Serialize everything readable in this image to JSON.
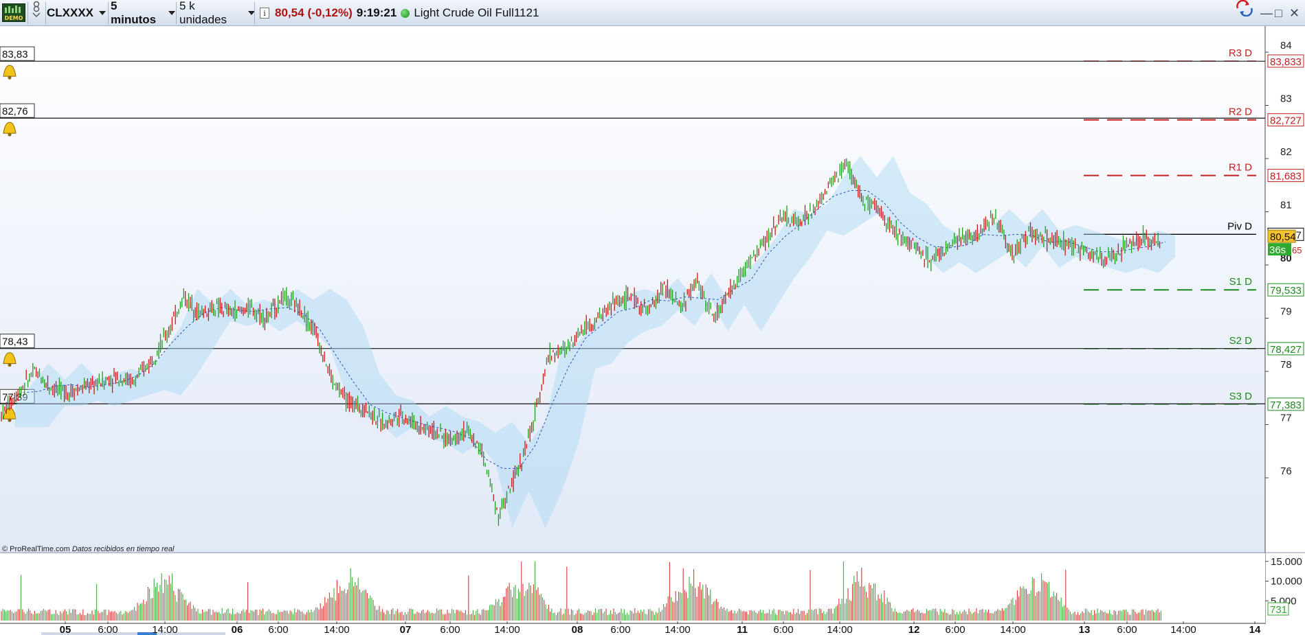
{
  "toolbar": {
    "logo": "DEMO",
    "symbol": "CLXXXX",
    "interval": "5 minutos",
    "units": "5 k unidades",
    "price": "80,54",
    "change": "(-0,12%)",
    "time": "9:19:21",
    "instrument": "Light Crude Oil Full1121"
  },
  "colors": {
    "up": "#1aa01a",
    "down": "#d01515",
    "resistance": "#c41e1e",
    "support": "#1d8a1d"
  },
  "icons": [
    "alert-bell-icon",
    "info-icon",
    "status-dot-icon",
    "minimize-icon",
    "restore-icon",
    "close-icon",
    "sync-icon"
  ],
  "footer": {
    "source": "© ProRealTime.com",
    "note": "Datos recibidos en tiempo real"
  },
  "alert_labels": [
    "83,83",
    "82,76",
    "78,43",
    "77,39"
  ],
  "price_ticks": [
    "84",
    "83",
    "82",
    "81",
    "80",
    "79",
    "78",
    "77",
    "76"
  ],
  "volume_ticks": [
    "15.000",
    "10.000",
    "5.000"
  ],
  "volume_last": "731",
  "last_price_box": "80,54",
  "countdown": "36s",
  "partial_label": "65",
  "time_labels": [
    "05",
    "6:00",
    "14:00",
    "06",
    "6:00",
    "14:00",
    "07",
    "6:00",
    "14:00",
    "08",
    "6:00",
    "14:00",
    "11",
    "6:00",
    "14:00",
    "12",
    "6:00",
    "14:00",
    "13",
    "6:00",
    "14:00",
    "14"
  ],
  "pivots": [
    {
      "label": "R3 D",
      "value": "83,833"
    },
    {
      "label": "R2 D",
      "value": "82,727"
    },
    {
      "label": "R1 D",
      "value": "81,683"
    },
    {
      "label": "Piv D",
      "value": "80,577"
    },
    {
      "label": "S1 D",
      "value": "79,533"
    },
    {
      "label": "S2 D",
      "value": "78,427"
    },
    {
      "label": "S3 D",
      "value": "77,383"
    }
  ],
  "chart_data": {
    "type": "line",
    "title": "",
    "y_range": [
      75,
      84.4
    ],
    "horizontal_lines": [
      83.83,
      82.76,
      78.43,
      77.39
    ],
    "pivot_levels": [
      83.833,
      82.727,
      81.683,
      80.577,
      79.533,
      78.427,
      77.383
    ],
    "last_price": 80.54,
    "price_path": [
      77.2,
      77.6,
      78.0,
      77.7,
      77.6,
      77.7,
      77.8,
      77.9,
      77.8,
      78.2,
      78.7,
      79.4,
      79.1,
      79.2,
      79.1,
      79.2,
      79.0,
      79.4,
      79.2,
      78.7,
      77.8,
      77.4,
      77.3,
      77.0,
      77.2,
      77.0,
      76.9,
      76.7,
      76.9,
      76.5,
      75.3,
      76.0,
      76.9,
      78.3,
      78.4,
      78.8,
      79.0,
      79.3,
      79.4,
      79.1,
      79.6,
      79.2,
      79.7,
      79.0,
      79.5,
      80.0,
      80.4,
      80.9,
      80.8,
      81.0,
      81.5,
      81.9,
      81.2,
      81.0,
      80.6,
      80.4,
      80.1,
      80.3,
      80.5,
      80.6,
      80.9,
      80.2,
      80.6,
      80.5,
      80.4,
      80.3,
      80.2,
      80.1,
      80.4,
      80.5,
      80.4
    ],
    "volume_ticks": [
      5000,
      10000,
      15000
    ]
  }
}
